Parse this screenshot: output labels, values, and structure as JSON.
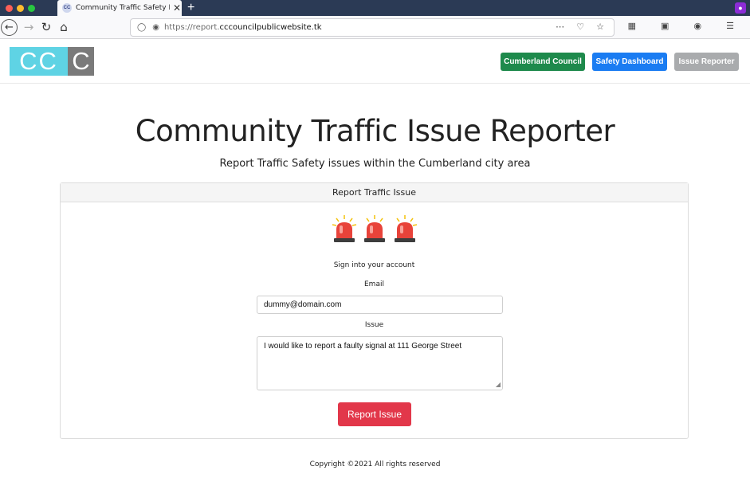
{
  "browser": {
    "tab_title": "Community Traffic Safety Dashb",
    "tab_favicon": "CC",
    "url_prefix": "https://report.",
    "url_domain": "cccouncilpublicwebsite.tk",
    "new_tab": "+",
    "close_tab": "✕"
  },
  "header": {
    "logo_left": "CC",
    "logo_right": "C",
    "buttons": [
      {
        "label": "Cumberland Council",
        "color": "#1e8a4c"
      },
      {
        "label": "Safety Dashboard",
        "color": "#1a7cf2"
      },
      {
        "label": "Issue Reporter",
        "color": "#a9abad"
      }
    ]
  },
  "main": {
    "title": "Community Traffic Issue Reporter",
    "subtitle": "Report Traffic Safety issues within the Cumberland city area"
  },
  "card": {
    "header": "Report Traffic Issue",
    "icon": "siren-icon",
    "signin_text": "Sign into your account",
    "email_label": "Email",
    "email_value": "dummy@domain.com",
    "issue_label": "Issue",
    "issue_value": "I would like to report a faulty signal at 111 George Street",
    "submit_label": "Report Issue",
    "submit_color": "#e2374a"
  },
  "footer": {
    "text": "Copyright ©2021 All rights reserved"
  }
}
